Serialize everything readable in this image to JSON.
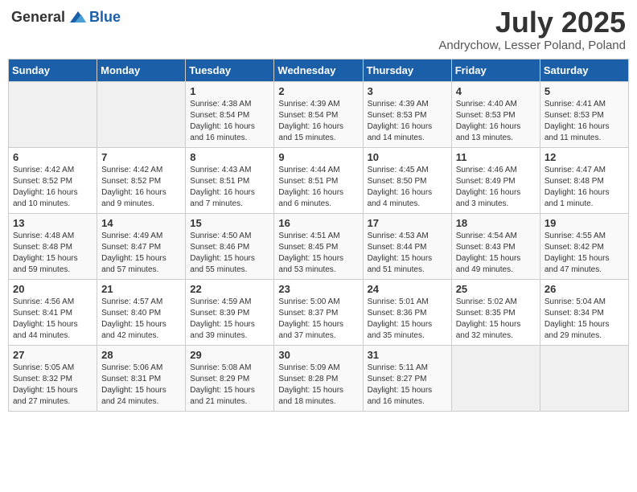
{
  "header": {
    "logo_general": "General",
    "logo_blue": "Blue",
    "month": "July 2025",
    "location": "Andrychow, Lesser Poland, Poland"
  },
  "days_of_week": [
    "Sunday",
    "Monday",
    "Tuesday",
    "Wednesday",
    "Thursday",
    "Friday",
    "Saturday"
  ],
  "weeks": [
    [
      {
        "day": "",
        "sunrise": "",
        "sunset": "",
        "daylight": ""
      },
      {
        "day": "",
        "sunrise": "",
        "sunset": "",
        "daylight": ""
      },
      {
        "day": "1",
        "sunrise": "Sunrise: 4:38 AM",
        "sunset": "Sunset: 8:54 PM",
        "daylight": "Daylight: 16 hours and 16 minutes."
      },
      {
        "day": "2",
        "sunrise": "Sunrise: 4:39 AM",
        "sunset": "Sunset: 8:54 PM",
        "daylight": "Daylight: 16 hours and 15 minutes."
      },
      {
        "day": "3",
        "sunrise": "Sunrise: 4:39 AM",
        "sunset": "Sunset: 8:53 PM",
        "daylight": "Daylight: 16 hours and 14 minutes."
      },
      {
        "day": "4",
        "sunrise": "Sunrise: 4:40 AM",
        "sunset": "Sunset: 8:53 PM",
        "daylight": "Daylight: 16 hours and 13 minutes."
      },
      {
        "day": "5",
        "sunrise": "Sunrise: 4:41 AM",
        "sunset": "Sunset: 8:53 PM",
        "daylight": "Daylight: 16 hours and 11 minutes."
      }
    ],
    [
      {
        "day": "6",
        "sunrise": "Sunrise: 4:42 AM",
        "sunset": "Sunset: 8:52 PM",
        "daylight": "Daylight: 16 hours and 10 minutes."
      },
      {
        "day": "7",
        "sunrise": "Sunrise: 4:42 AM",
        "sunset": "Sunset: 8:52 PM",
        "daylight": "Daylight: 16 hours and 9 minutes."
      },
      {
        "day": "8",
        "sunrise": "Sunrise: 4:43 AM",
        "sunset": "Sunset: 8:51 PM",
        "daylight": "Daylight: 16 hours and 7 minutes."
      },
      {
        "day": "9",
        "sunrise": "Sunrise: 4:44 AM",
        "sunset": "Sunset: 8:51 PM",
        "daylight": "Daylight: 16 hours and 6 minutes."
      },
      {
        "day": "10",
        "sunrise": "Sunrise: 4:45 AM",
        "sunset": "Sunset: 8:50 PM",
        "daylight": "Daylight: 16 hours and 4 minutes."
      },
      {
        "day": "11",
        "sunrise": "Sunrise: 4:46 AM",
        "sunset": "Sunset: 8:49 PM",
        "daylight": "Daylight: 16 hours and 3 minutes."
      },
      {
        "day": "12",
        "sunrise": "Sunrise: 4:47 AM",
        "sunset": "Sunset: 8:48 PM",
        "daylight": "Daylight: 16 hours and 1 minute."
      }
    ],
    [
      {
        "day": "13",
        "sunrise": "Sunrise: 4:48 AM",
        "sunset": "Sunset: 8:48 PM",
        "daylight": "Daylight: 15 hours and 59 minutes."
      },
      {
        "day": "14",
        "sunrise": "Sunrise: 4:49 AM",
        "sunset": "Sunset: 8:47 PM",
        "daylight": "Daylight: 15 hours and 57 minutes."
      },
      {
        "day": "15",
        "sunrise": "Sunrise: 4:50 AM",
        "sunset": "Sunset: 8:46 PM",
        "daylight": "Daylight: 15 hours and 55 minutes."
      },
      {
        "day": "16",
        "sunrise": "Sunrise: 4:51 AM",
        "sunset": "Sunset: 8:45 PM",
        "daylight": "Daylight: 15 hours and 53 minutes."
      },
      {
        "day": "17",
        "sunrise": "Sunrise: 4:53 AM",
        "sunset": "Sunset: 8:44 PM",
        "daylight": "Daylight: 15 hours and 51 minutes."
      },
      {
        "day": "18",
        "sunrise": "Sunrise: 4:54 AM",
        "sunset": "Sunset: 8:43 PM",
        "daylight": "Daylight: 15 hours and 49 minutes."
      },
      {
        "day": "19",
        "sunrise": "Sunrise: 4:55 AM",
        "sunset": "Sunset: 8:42 PM",
        "daylight": "Daylight: 15 hours and 47 minutes."
      }
    ],
    [
      {
        "day": "20",
        "sunrise": "Sunrise: 4:56 AM",
        "sunset": "Sunset: 8:41 PM",
        "daylight": "Daylight: 15 hours and 44 minutes."
      },
      {
        "day": "21",
        "sunrise": "Sunrise: 4:57 AM",
        "sunset": "Sunset: 8:40 PM",
        "daylight": "Daylight: 15 hours and 42 minutes."
      },
      {
        "day": "22",
        "sunrise": "Sunrise: 4:59 AM",
        "sunset": "Sunset: 8:39 PM",
        "daylight": "Daylight: 15 hours and 39 minutes."
      },
      {
        "day": "23",
        "sunrise": "Sunrise: 5:00 AM",
        "sunset": "Sunset: 8:37 PM",
        "daylight": "Daylight: 15 hours and 37 minutes."
      },
      {
        "day": "24",
        "sunrise": "Sunrise: 5:01 AM",
        "sunset": "Sunset: 8:36 PM",
        "daylight": "Daylight: 15 hours and 35 minutes."
      },
      {
        "day": "25",
        "sunrise": "Sunrise: 5:02 AM",
        "sunset": "Sunset: 8:35 PM",
        "daylight": "Daylight: 15 hours and 32 minutes."
      },
      {
        "day": "26",
        "sunrise": "Sunrise: 5:04 AM",
        "sunset": "Sunset: 8:34 PM",
        "daylight": "Daylight: 15 hours and 29 minutes."
      }
    ],
    [
      {
        "day": "27",
        "sunrise": "Sunrise: 5:05 AM",
        "sunset": "Sunset: 8:32 PM",
        "daylight": "Daylight: 15 hours and 27 minutes."
      },
      {
        "day": "28",
        "sunrise": "Sunrise: 5:06 AM",
        "sunset": "Sunset: 8:31 PM",
        "daylight": "Daylight: 15 hours and 24 minutes."
      },
      {
        "day": "29",
        "sunrise": "Sunrise: 5:08 AM",
        "sunset": "Sunset: 8:29 PM",
        "daylight": "Daylight: 15 hours and 21 minutes."
      },
      {
        "day": "30",
        "sunrise": "Sunrise: 5:09 AM",
        "sunset": "Sunset: 8:28 PM",
        "daylight": "Daylight: 15 hours and 18 minutes."
      },
      {
        "day": "31",
        "sunrise": "Sunrise: 5:11 AM",
        "sunset": "Sunset: 8:27 PM",
        "daylight": "Daylight: 15 hours and 16 minutes."
      },
      {
        "day": "",
        "sunrise": "",
        "sunset": "",
        "daylight": ""
      },
      {
        "day": "",
        "sunrise": "",
        "sunset": "",
        "daylight": ""
      }
    ]
  ]
}
